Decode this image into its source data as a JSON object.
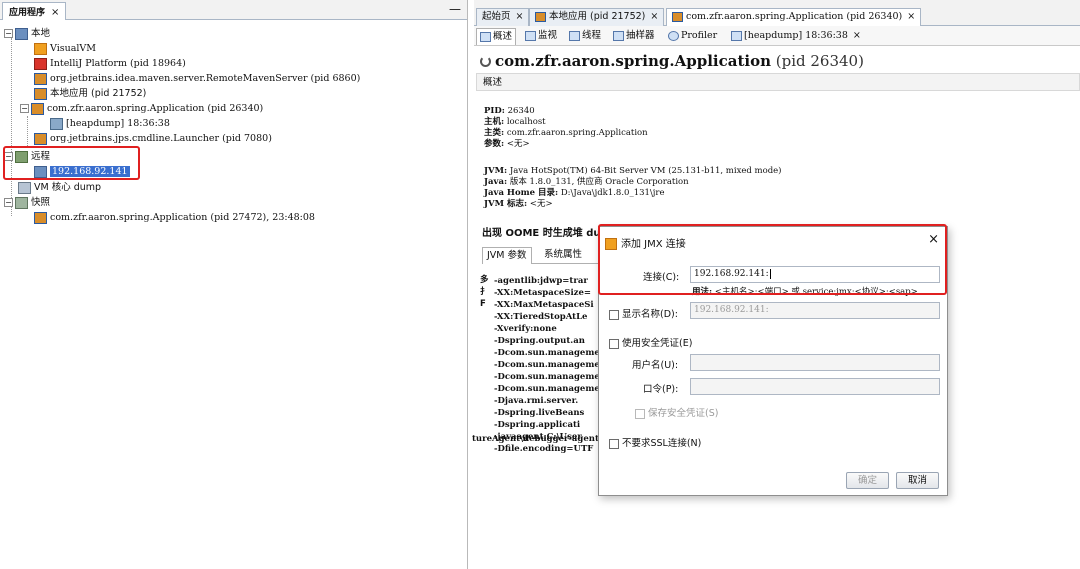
{
  "left_panel": {
    "tab_label": "应用程序",
    "tab_close": "×",
    "minimize": "—",
    "tree": {
      "local": {
        "label": "本地",
        "children": [
          "VisualVM",
          "IntelliJ Platform (pid 18964)",
          "org.jetbrains.idea.maven.server.RemoteMavenServer (pid 6860)",
          "本地应用 (pid 21752)",
          "com.zfr.aaron.spring.Application (pid 26340)",
          "[heapdump] 18:36:38",
          "org.jetbrains.jps.cmdline.Launcher (pid 7080)"
        ]
      },
      "remote": {
        "label": "远程",
        "host": "192.168.92.141"
      },
      "core_dump": "VM 核心 dump",
      "snapshots": {
        "label": "快照",
        "item": "com.zfr.aaron.spring.Application (pid 27472), 23:48:08"
      }
    }
  },
  "doc_tabs": [
    {
      "label": "起始页",
      "close": "×"
    },
    {
      "label": "本地应用 (pid 21752)",
      "close": "×"
    },
    {
      "label": "com.zfr.aaron.spring.Application (pid 26340)",
      "close": "×"
    }
  ],
  "sub_tabs": {
    "items": [
      "概述",
      "监视",
      "线程",
      "抽样器",
      "Profiler",
      "[heapdump] 18:36:38"
    ],
    "close": "×"
  },
  "overview": {
    "title": "com.zfr.aaron.spring.Application",
    "title_pid": "(pid 26340)",
    "section_label": "概述",
    "pid_key": "PID:",
    "pid_val": "26340",
    "host_key": "主机:",
    "host_val": "localhost",
    "class_key": "主类:",
    "class_val": "com.zfr.aaron.spring.Application",
    "args_key": "参数:",
    "args_val": "<无>",
    "jvm_key": "JVM:",
    "jvm_val": "Java HotSpot(TM) 64-Bit Server VM (25.131-b11, mixed mode)",
    "java_key": "Java:",
    "java_val": "版本 1.8.0_131, 供应商 Oracle Corporation",
    "javahome_key": "Java Home 目录:",
    "javahome_val": "D:\\Java\\jdk1.8.0_131\\jre",
    "jvmflags_key": "JVM 标志:",
    "jvmflags_val": "<无>",
    "oome_label": "出现 OOME 时生成堆 du"
  },
  "jvm_tabs": [
    "JVM 参数",
    "系统属性"
  ],
  "jvm_args": [
    "-agentlib:jdwp=trar",
    "-XX:MetaspaceSize=",
    "-XX:MaxMetaspaceSi",
    "-XX:TieredStopAtLe",
    "-Xverify:none",
    "-Dspring.output.an",
    "-Dcom.sun.manageme",
    "-Dcom.sun.manageme",
    "-Dcom.sun.manageme",
    "-Dcom.sun.manageme",
    "-Djava.rmi.server.",
    "-Dspring.liveBeans",
    "-Dspring.applicati",
    "-javaagent:C:\\User",
    "-Dfile.encoding=UTF"
  ],
  "jvm_args_left_fragments": [
    "多",
    "扌",
    "F"
  ],
  "jvm_args_right_fragment": "tureAgent\\debugger-agent",
  "dialog": {
    "title": "添加 JMX 连接",
    "close": "×",
    "connection_label": "连接(C):",
    "connection_value": "192.168.92.141:",
    "usage_key": "用法:",
    "usage_val": "<主机名>:<端口> 或 service:jmx:<协议>:<sap>",
    "display_name_label": "显示名称(D):",
    "display_name_value": "192.168.92.141:",
    "use_security_label": "使用安全凭证(E)",
    "username_label": "用户名(U):",
    "password_label": "口令(P):",
    "save_security_label": "保存安全凭证(S)",
    "no_ssl_label": "不要求SSL连接(N)",
    "ok_label": "确定",
    "cancel_label": "取消"
  },
  "colors": {
    "highlight_border": "#e02020",
    "selection_bg": "#3a6fcf",
    "tab_border": "#a9b6c6"
  }
}
